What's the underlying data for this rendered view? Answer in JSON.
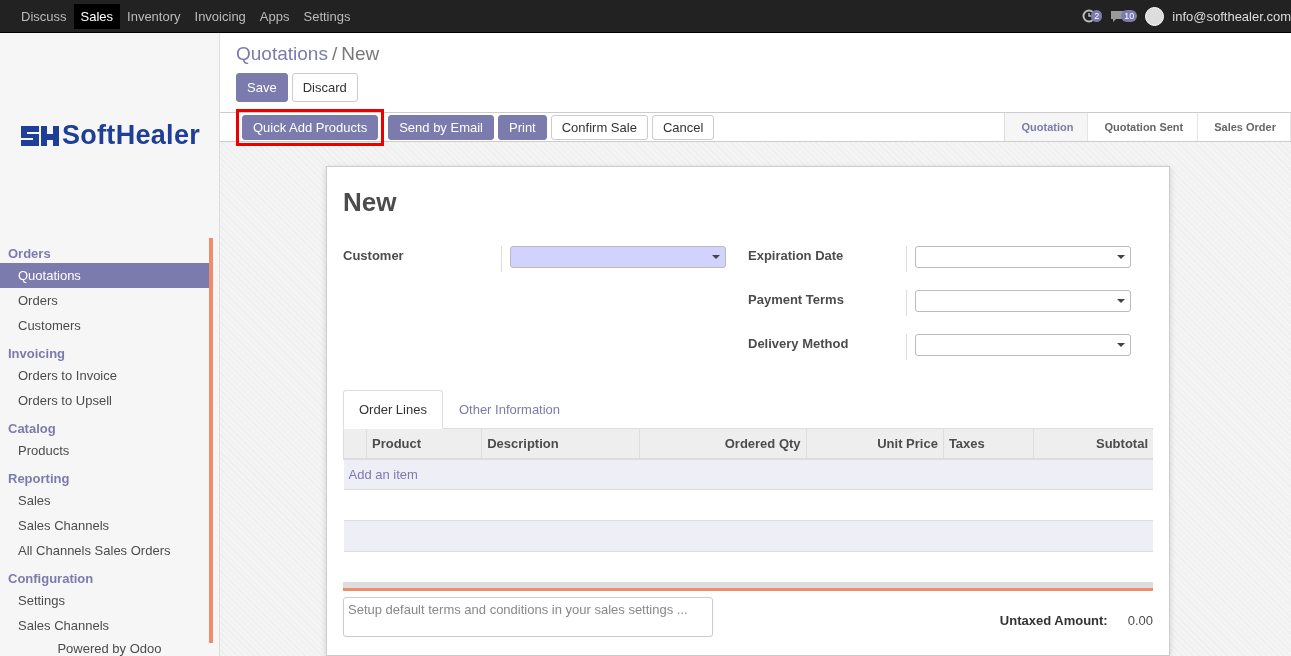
{
  "navbar": {
    "menu": [
      {
        "label": "Discuss",
        "selected": false
      },
      {
        "label": "Sales",
        "selected": true
      },
      {
        "label": "Inventory",
        "selected": false
      },
      {
        "label": "Invoicing",
        "selected": false
      },
      {
        "label": "Apps",
        "selected": false
      },
      {
        "label": "Settings",
        "selected": false
      }
    ],
    "activity_count": "2",
    "message_count": "10",
    "user_email": "info@softhealer.com"
  },
  "sidebar": {
    "logo_text": "SoftHealer",
    "sections": [
      {
        "title": "Orders",
        "items": [
          {
            "label": "Quotations",
            "selected": true
          },
          {
            "label": "Orders",
            "selected": false
          },
          {
            "label": "Customers",
            "selected": false
          }
        ]
      },
      {
        "title": "Invoicing",
        "items": [
          {
            "label": "Orders to Invoice",
            "selected": false
          },
          {
            "label": "Orders to Upsell",
            "selected": false
          }
        ]
      },
      {
        "title": "Catalog",
        "items": [
          {
            "label": "Products",
            "selected": false
          }
        ]
      },
      {
        "title": "Reporting",
        "items": [
          {
            "label": "Sales",
            "selected": false
          },
          {
            "label": "Sales Channels",
            "selected": false
          },
          {
            "label": "All Channels Sales Orders",
            "selected": false
          }
        ]
      },
      {
        "title": "Configuration",
        "items": [
          {
            "label": "Settings",
            "selected": false
          },
          {
            "label": "Sales Channels",
            "selected": false
          }
        ]
      }
    ],
    "footer": "Powered by Odoo"
  },
  "breadcrumb": {
    "parent": "Quotations",
    "separator": "/",
    "current": "New"
  },
  "edit_buttons": [
    {
      "label": "Save",
      "kind": "primary"
    },
    {
      "label": "Discard",
      "kind": "secondary"
    }
  ],
  "action_buttons": [
    {
      "label": "Quick Add Products",
      "kind": "primary",
      "highlighted": true
    },
    {
      "label": "Send by Email",
      "kind": "primary",
      "highlighted": false
    },
    {
      "label": "Print",
      "kind": "primary",
      "highlighted": false
    },
    {
      "label": "Confirm Sale",
      "kind": "secondary",
      "highlighted": false
    },
    {
      "label": "Cancel",
      "kind": "secondary",
      "highlighted": false
    }
  ],
  "status_steps": [
    {
      "label": "Quotation",
      "selected": true
    },
    {
      "label": "Quotation Sent",
      "selected": false
    },
    {
      "label": "Sales Order",
      "selected": false
    }
  ],
  "form": {
    "title": "New",
    "left_fields": [
      {
        "label": "Customer",
        "required": true
      }
    ],
    "right_fields": [
      {
        "label": "Expiration Date",
        "required": false
      },
      {
        "label": "Payment Terms",
        "required": false
      },
      {
        "label": "Delivery Method",
        "required": false
      }
    ],
    "tabs": [
      {
        "label": "Order Lines",
        "selected": true
      },
      {
        "label": "Other Information",
        "selected": false
      }
    ],
    "table": {
      "columns": [
        {
          "label": "Product",
          "numeric": false
        },
        {
          "label": "Description",
          "numeric": false
        },
        {
          "label": "Ordered Qty",
          "numeric": true
        },
        {
          "label": "Unit Price",
          "numeric": true
        },
        {
          "label": "Taxes",
          "numeric": false
        },
        {
          "label": "Subtotal",
          "numeric": true
        }
      ],
      "add_link": "Add an item"
    },
    "notes_placeholder": "Setup default terms and conditions in your sales settings ...",
    "totals": [
      {
        "label": "Untaxed Amount:",
        "value": "0.00"
      }
    ]
  }
}
